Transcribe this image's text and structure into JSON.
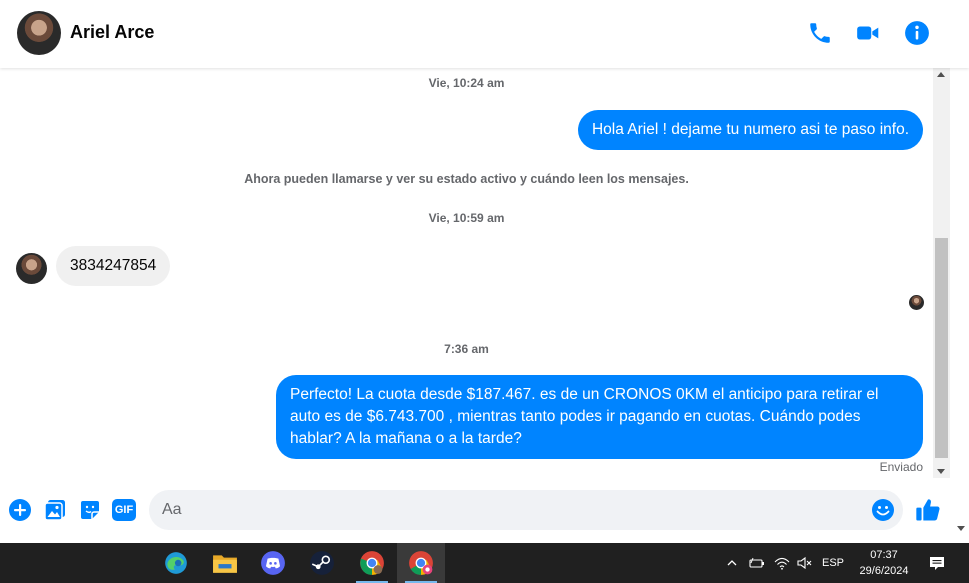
{
  "header": {
    "contact_name": "Ariel Arce",
    "icons": [
      "phone-icon",
      "video-camera-icon",
      "info-icon"
    ],
    "accent_color": "#0084ff"
  },
  "chat": {
    "timestamps": [
      "Vie, 10:24 am",
      "Vie, 10:59 am",
      "7:36 am"
    ],
    "system_message": "Ahora pueden llamarse y ver su estado activo y cuándo leen los mensajes.",
    "messages": [
      {
        "direction": "outgoing",
        "text": "Hola Ariel ! dejame tu numero asi te paso info."
      },
      {
        "direction": "incoming",
        "text": "3834247854"
      },
      {
        "direction": "outgoing",
        "text_lines": [
          "Perfecto! La cuota desde $187.467. es de un CRONOS 0KM el anticipo para retirar el",
          "auto es de $6.743.700 , mientras tanto podes ir pagando en cuotas. Cuándo podes",
          "hablar? A la mañana o a la tarde?"
        ]
      }
    ],
    "delivery_status": "Enviado"
  },
  "composer": {
    "placeholder": "Aa",
    "icons": [
      "plus-icon",
      "gallery-icon",
      "sticker-icon",
      "gif-icon",
      "emoji-icon",
      "thumbs-up-icon"
    ],
    "gif_label": "GIF"
  },
  "taskbar": {
    "apps": [
      "edge-icon",
      "file-explorer-icon",
      "discord-icon",
      "steam-icon",
      "chrome-icon",
      "chrome-profile-icon"
    ],
    "language": "ESP",
    "time": "07:37",
    "date": "29/6/2024"
  }
}
